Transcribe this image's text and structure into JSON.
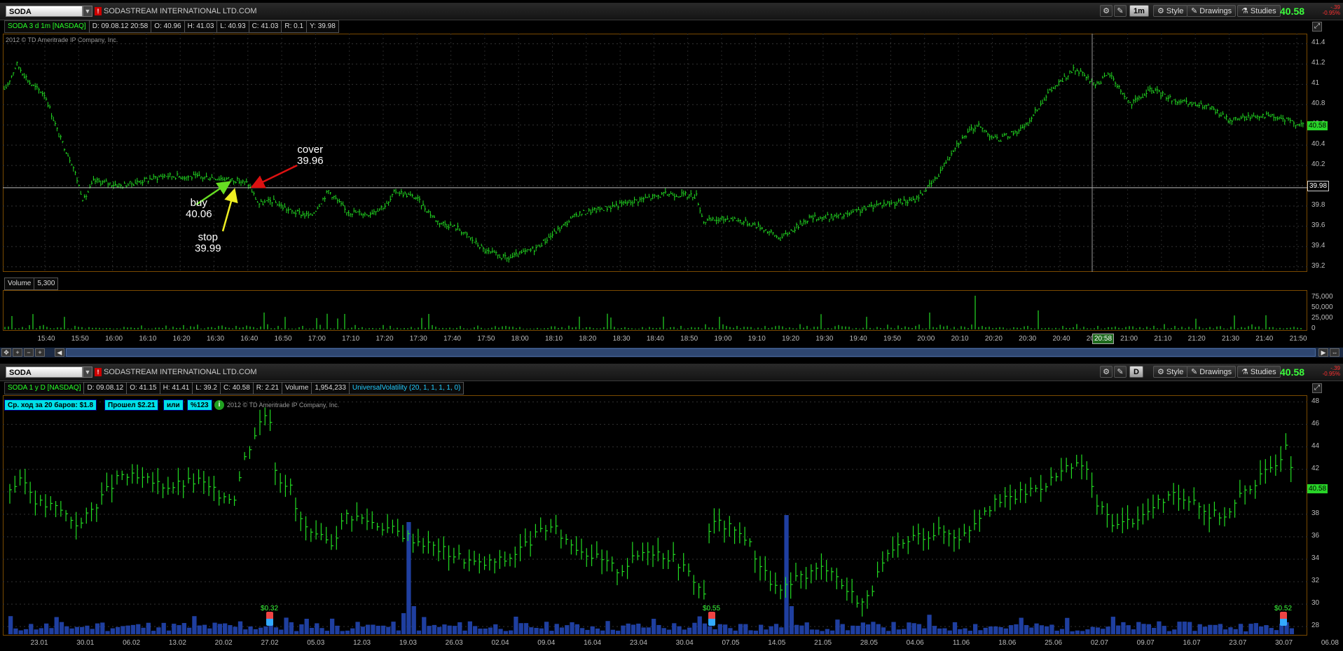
{
  "top_panel": {
    "symbol": "SODA",
    "company": "SODASTREAM INTERNATIONAL LTD.COM",
    "aggregation": "1m",
    "style_label": "Style",
    "drawings_label": "Drawings",
    "studies_label": "Studies",
    "last_price": "40.58",
    "change_top": "-.39",
    "change_pct": "-0.95%",
    "info": {
      "title": "SODA 3 d 1m [NASDAQ]",
      "date": "D: 09.08.12 20:58",
      "open": "O: 40.96",
      "high": "H: 41.03",
      "low": "L: 40.93",
      "close": "C: 41.03",
      "range": "R: 0.1",
      "y": "Y: 39.98"
    },
    "copyright": "2012 © TD Ameritrade IP Company, Inc.",
    "y_ticks": [
      "41.4",
      "41.2",
      "41",
      "40.8",
      "40.6",
      "40.4",
      "40.2",
      "40",
      "39.8",
      "39.6",
      "39.4",
      "39.2"
    ],
    "price_tag": "40.58",
    "crosshair_tag": "39.98",
    "volume_label": "Volume",
    "volume_value": "5,300",
    "vol_ticks": [
      "75,000",
      "50,000",
      "25,000",
      "0"
    ],
    "x_ticks": [
      "15:40",
      "15:50",
      "16:00",
      "16:10",
      "16:20",
      "16:30",
      "16:40",
      "16:50",
      "17:00",
      "17:10",
      "17:20",
      "17:30",
      "17:40",
      "17:50",
      "18:00",
      "18:10",
      "18:20",
      "18:30",
      "18:40",
      "18:50",
      "19:00",
      "19:10",
      "19:20",
      "19:30",
      "19:40",
      "19:50",
      "20:00",
      "20:10",
      "20:20",
      "20:30",
      "20:40",
      "20:50",
      "21:00",
      "21:10",
      "21:20",
      "21:30",
      "21:40",
      "21:50"
    ],
    "time_tag": "20:58",
    "annotations": {
      "cover": "cover",
      "cover_price": "39.96",
      "buy": "buy",
      "buy_price": "40.06",
      "stop": "stop",
      "stop_price": "39.99"
    }
  },
  "bottom_panel": {
    "symbol": "SODA",
    "company": "SODASTREAM INTERNATIONAL LTD.COM",
    "aggregation": "D",
    "style_label": "Style",
    "drawings_label": "Drawings",
    "studies_label": "Studies",
    "last_price": "40.58",
    "change_top": "-.39",
    "change_pct": "-0.95%",
    "info": {
      "title": "SODA 1 y D [NASDAQ]",
      "date": "D: 09.08.12",
      "open": "O: 41.15",
      "high": "H: 41.41",
      "low": "L: 39.2",
      "close": "C: 40.58",
      "range": "R: 2.21",
      "volume_label": "Volume",
      "volume": "1,954,233",
      "study": "UniversalVolatility (20, 1, 1, 1, 1, 0)"
    },
    "stats": {
      "avg": "Ср. ход за 20 баров: $1.8",
      "passed": "Прошел $2.21",
      "or": "или",
      "pct": "%123"
    },
    "copyright": "2012 © TD Ameritrade IP Company, Inc.",
    "y_ticks": [
      "48",
      "46",
      "44",
      "42",
      "40",
      "38",
      "36",
      "34",
      "32",
      "30",
      "28"
    ],
    "price_tag": "40.58",
    "dividends": [
      "$0.32",
      "$0.55",
      "$0.52"
    ],
    "x_ticks": [
      "23.01",
      "30.01",
      "06.02",
      "13.02",
      "20.02",
      "27.02",
      "05.03",
      "12.03",
      "19.03",
      "26.03",
      "02.04",
      "09.04",
      "16.04",
      "23.04",
      "30.04",
      "07.05",
      "14.05",
      "21.05",
      "28.05",
      "04.06",
      "11.06",
      "18.06",
      "25.06",
      "02.07",
      "09.07",
      "16.07",
      "23.07",
      "30.07",
      "06.08"
    ]
  },
  "colors": {
    "bars": "#22dd22",
    "volume_top": "#22cc22",
    "volume_bottom": "#1f3fa0",
    "arrow_cover": "#dd1111",
    "arrow_buy": "#66dd22",
    "arrow_stop": "#eeee22"
  }
}
